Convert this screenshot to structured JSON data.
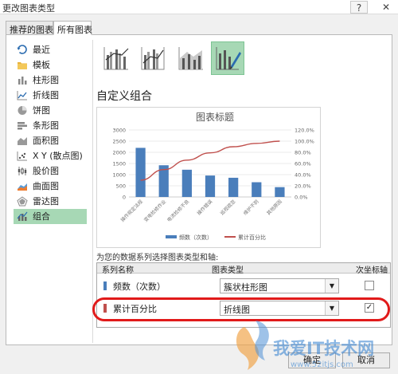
{
  "window": {
    "title": "更改图表类型",
    "help": "?",
    "close": "✕"
  },
  "tabs": [
    {
      "label": "推荐的图表"
    },
    {
      "label": "所有图表"
    }
  ],
  "categories": [
    {
      "label": "最近",
      "icon": "recent-icon"
    },
    {
      "label": "模板",
      "icon": "template-folder-icon"
    },
    {
      "label": "柱形图",
      "icon": "column-chart-icon"
    },
    {
      "label": "折线图",
      "icon": "line-chart-icon"
    },
    {
      "label": "饼图",
      "icon": "pie-chart-icon"
    },
    {
      "label": "条形图",
      "icon": "bar-chart-icon"
    },
    {
      "label": "面积图",
      "icon": "area-chart-icon"
    },
    {
      "label": "X Y (散点图)",
      "icon": "scatter-chart-icon"
    },
    {
      "label": "股价图",
      "icon": "stock-chart-icon"
    },
    {
      "label": "曲面图",
      "icon": "surface-chart-icon"
    },
    {
      "label": "雷达图",
      "icon": "radar-chart-icon"
    },
    {
      "label": "组合",
      "icon": "combo-chart-icon",
      "active": true
    }
  ],
  "combo": {
    "heading": "自定义组合",
    "selected_subtype": 4,
    "section_label": "为您的数据系列选择图表类型和轴:",
    "table_headers": {
      "series": "系列名称",
      "chart_type": "图表类型",
      "secondary": "次坐标轴"
    },
    "series": [
      {
        "name": "频数（次数）",
        "chart_type": "簇状柱形图",
        "secondary_axis": false,
        "color": "#4a7ebb"
      },
      {
        "name": "累计百分比",
        "chart_type": "折线图",
        "secondary_axis": true,
        "color": "#c0504d"
      }
    ]
  },
  "chart_data": {
    "type": "bar",
    "title": "图表标题",
    "categories": [
      "操作规定法规",
      "变电检修作业",
      "电流检修不良",
      "操作错误",
      "巡视疏忽",
      "维护不到",
      "其他原因"
    ],
    "series": [
      {
        "name": "频数（次数）",
        "type": "bar",
        "axis": "left",
        "color": "#4a7ebb",
        "values": [
          2200,
          1420,
          1220,
          960,
          860,
          660,
          440
        ]
      },
      {
        "name": "累计百分比",
        "type": "line",
        "axis": "right",
        "color": "#c0504d",
        "values": [
          0.3,
          0.49,
          0.66,
          0.79,
          0.9,
          0.96,
          1.0
        ]
      }
    ],
    "ylim": [
      0,
      3000
    ],
    "yticks": [
      "0",
      "500",
      "1000",
      "1500",
      "2000",
      "2500",
      "3000"
    ],
    "y2lim": [
      0,
      1.2
    ],
    "y2ticks": [
      "0.0%",
      "20.0%",
      "40.0%",
      "60.0%",
      "80.0%",
      "100.0%",
      "120.0%"
    ],
    "legend_placement": "bottom",
    "grid": true
  },
  "buttons": {
    "ok": "确定",
    "cancel": "取消"
  },
  "watermark": {
    "text": "我爱IT技术网",
    "url": "www.52itjs.com"
  }
}
